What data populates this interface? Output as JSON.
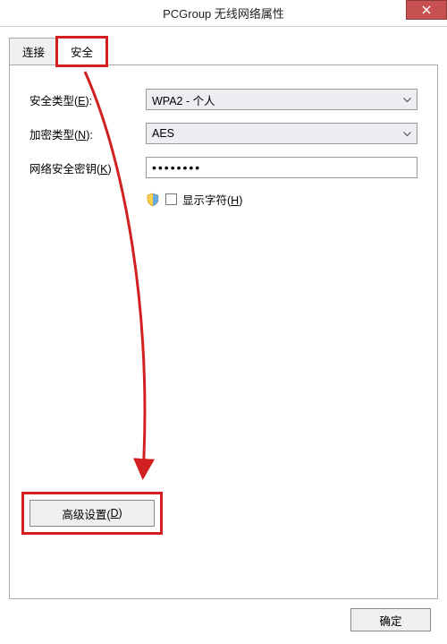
{
  "window": {
    "title": "PCGroup 无线网络属性"
  },
  "tabs": {
    "connect": "连接",
    "security": "安全"
  },
  "security_form": {
    "security_type_label": "安全类型(",
    "security_type_ak": "E",
    "security_type_suffix": "):",
    "security_type_value": "WPA2 - 个人",
    "encryption_label": "加密类型(",
    "encryption_ak": "N",
    "encryption_suffix": "):",
    "encryption_value": "AES",
    "key_label": "网络安全密钥(",
    "key_ak": "K",
    "key_suffix": ")",
    "key_value": "••••••••",
    "show_chars_label": "显示字符(",
    "show_chars_ak": "H",
    "show_chars_suffix": ")"
  },
  "advanced": {
    "label": "高级设置(",
    "ak": "D",
    "suffix": ")"
  },
  "buttons": {
    "ok": "确定"
  },
  "annotation": {
    "arrow_color": "#d22020"
  }
}
